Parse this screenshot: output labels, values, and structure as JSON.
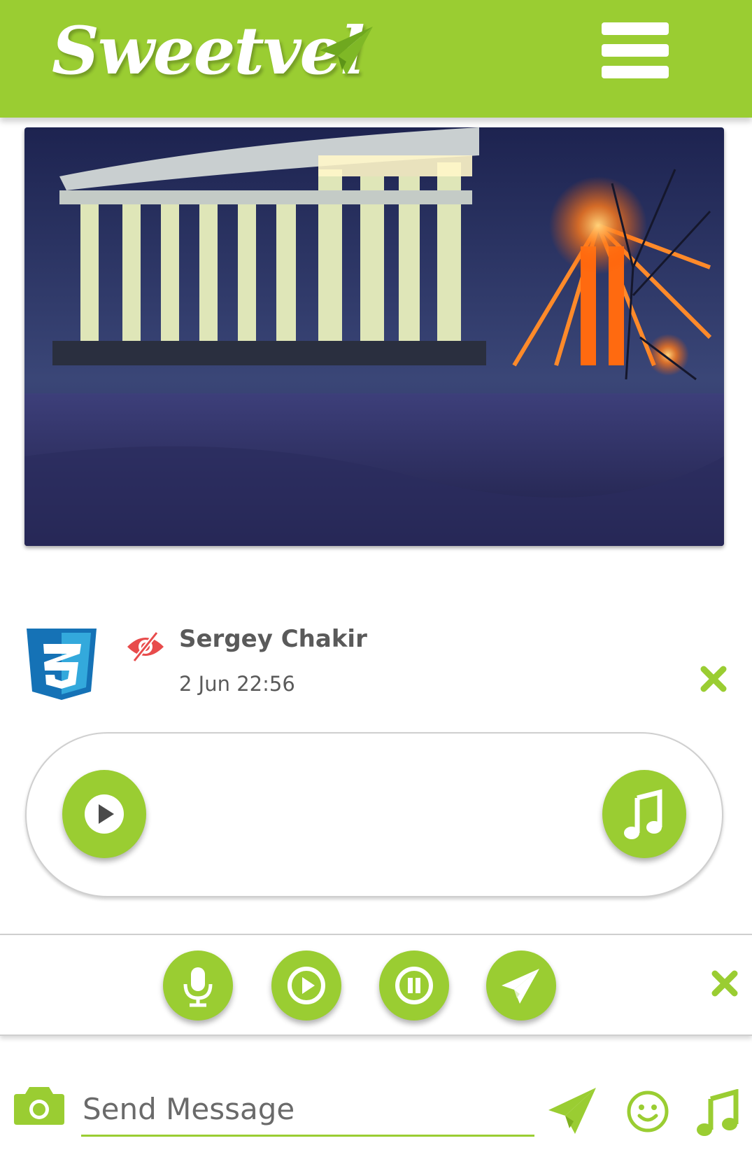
{
  "app": {
    "brand": "Sweetvel",
    "accent": "#9acd32"
  },
  "message": {
    "sender": "Sergey Chakir",
    "time": "2 Jun 22:56",
    "avatar_icon": "css3-logo-icon",
    "status_icon": "unseen-eye-icon"
  },
  "composer": {
    "placeholder": "Send Message",
    "value": ""
  }
}
